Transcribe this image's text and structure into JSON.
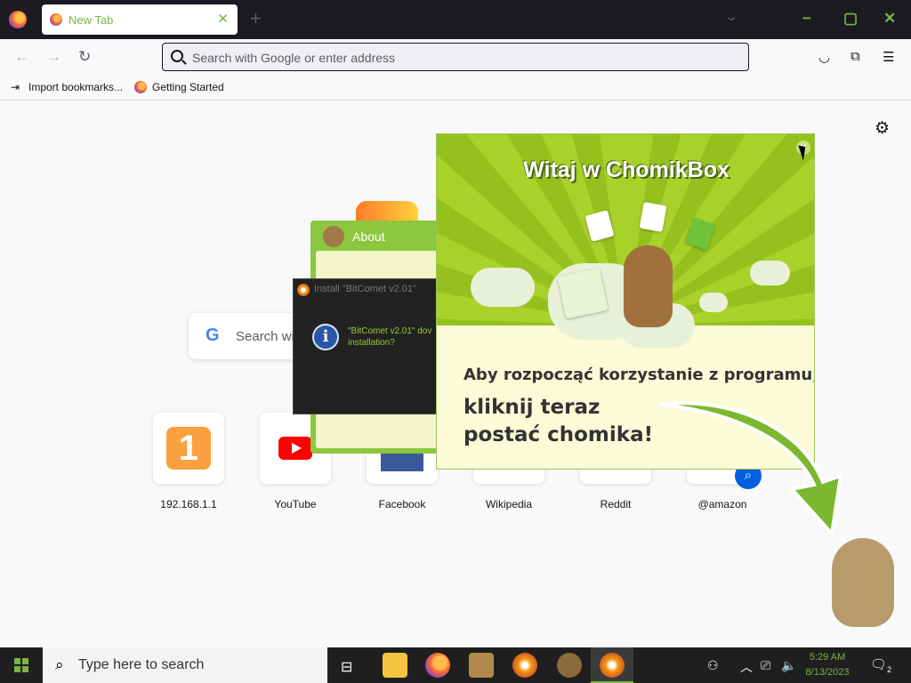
{
  "browser": {
    "tab_title": "New Tab",
    "tab_close": "✕",
    "new_tab": "+",
    "tab_list": "⌄",
    "url_placeholder": "Search with Google or enter address",
    "window_controls": {
      "minimize": "−",
      "restore": "▢",
      "close": "✕"
    }
  },
  "bookmarks": {
    "import": "Import bookmarks...",
    "getting_started": "Getting Started"
  },
  "newtab": {
    "search_placeholder": "Search wi",
    "google_logo": "G",
    "sites": [
      {
        "label": "192.168.1.1",
        "glyph": "1"
      },
      {
        "label": "YouTube"
      },
      {
        "label": "Facebook"
      },
      {
        "label": "Wikipedia"
      },
      {
        "label": "Reddit"
      },
      {
        "label": "@amazon"
      }
    ]
  },
  "about_window": {
    "title": "About"
  },
  "bitcomet_dialog": {
    "title": "Install \"BitComet v2.01\"",
    "message_line1": "\"BitComet v2.01\" dov",
    "message_line2": "installation?",
    "info_glyph": "i"
  },
  "chomikbox": {
    "heading": "Witaj w ChomikBox",
    "line1": "Aby rozpocząć korzystanie z programu,",
    "line2": "kliknij teraz",
    "line3": "postać chomika!",
    "close_glyph": "✕"
  },
  "taskbar": {
    "search_placeholder": "Type here to search",
    "time": "5:29 AM",
    "date": "8/13/2023",
    "notification_count": "2"
  },
  "colors": {
    "accent": "#7cb342",
    "chomik_green": "#95c11f",
    "taskbar": "#1f1f1f"
  }
}
